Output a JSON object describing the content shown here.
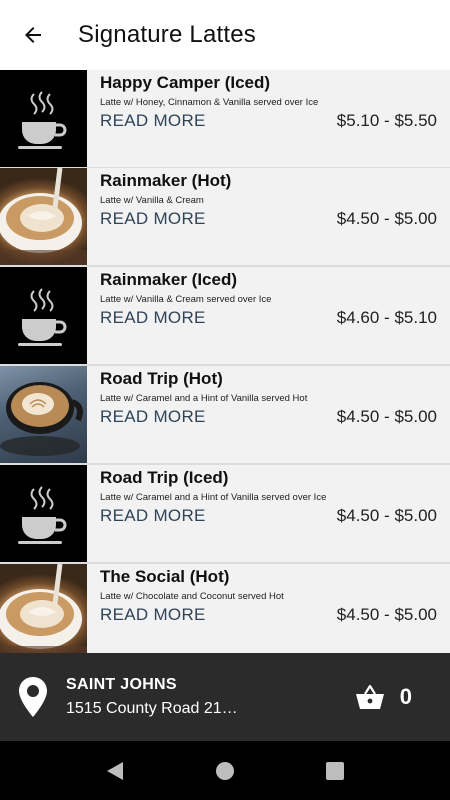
{
  "app_bar": {
    "title": "Signature Lattes",
    "back_icon": "arrow-left-icon"
  },
  "items": [
    {
      "name": "Happy Camper (Iced)",
      "description": "Latte w/ Honey, Cinnamon & Vanilla served over Ice",
      "read_more": "READ MORE",
      "price": "$5.10 - $5.50",
      "thumb": "steaming-cup-icon"
    },
    {
      "name": "Rainmaker (Hot)",
      "description": "Latte w/ Vanilla & Cream",
      "read_more": "READ MORE",
      "price": "$4.50 - $5.00",
      "thumb": "latte-photo"
    },
    {
      "name": "Rainmaker (Iced)",
      "description": "Latte w/ Vanilla & Cream served over Ice",
      "read_more": "READ MORE",
      "price": "$4.60 - $5.10",
      "thumb": "steaming-cup-icon"
    },
    {
      "name": "Road Trip (Hot)",
      "description": "Latte w/ Caramel and a Hint of Vanilla served Hot",
      "read_more": "READ MORE",
      "price": "$4.50 - $5.00",
      "thumb": "latte-art-photo"
    },
    {
      "name": "Road Trip (Iced)",
      "description": "Latte w/ Caramel and a Hint of Vanilla served over Ice",
      "read_more": "READ MORE",
      "price": "$4.50 - $5.00",
      "thumb": "steaming-cup-icon"
    },
    {
      "name": "The Social (Hot)",
      "description": "Latte w/ Chocolate and Coconut served Hot",
      "read_more": "READ MORE",
      "price": "$4.50 - $5.00",
      "thumb": "latte-photo"
    }
  ],
  "store_bar": {
    "store_name": "SAINT JOHNS",
    "address": "1515 County Road 21…",
    "cart_count": "0",
    "pin_icon": "location-pin-icon",
    "cart_icon": "basket-icon"
  },
  "colors": {
    "app_bar_bg": "#ffffff",
    "item_bg": "#f2f2f2",
    "read_more": "#2f4459",
    "bottom_bar_bg": "#2b2b2b",
    "nav_bar_bg": "#000000"
  }
}
